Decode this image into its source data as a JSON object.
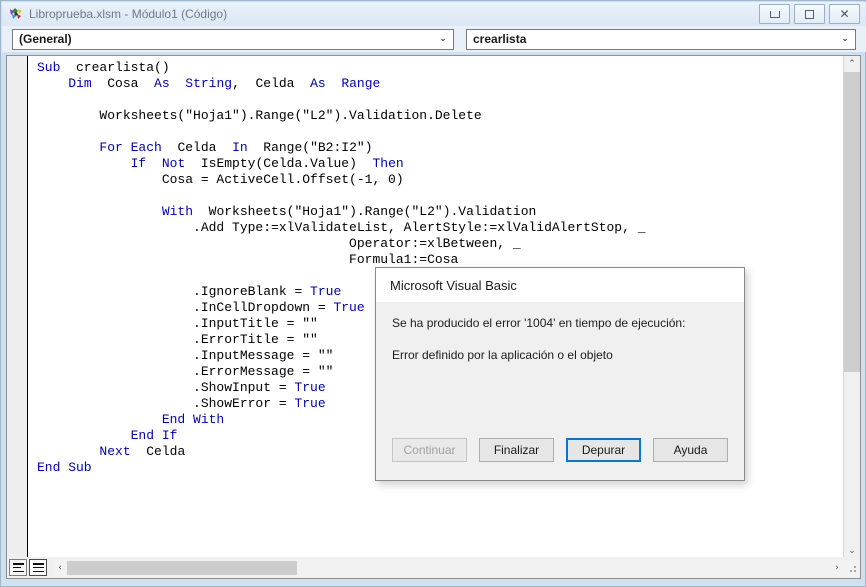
{
  "window": {
    "title": "Libroprueba.xlsm - Módulo1 (Código)",
    "icon": "vba-icon",
    "buttons": {
      "minimize": "minimize-button",
      "restore": "restore-button",
      "close": "close-button"
    }
  },
  "toolbar": {
    "object_combo": {
      "value": "(General)",
      "arrow": "⌄"
    },
    "procedure_combo": {
      "value": "crearlista",
      "arrow": "⌄"
    }
  },
  "code": {
    "lines": [
      [
        [
          "kw",
          "Sub"
        ],
        [
          "",
          "  crearlista()"
        ]
      ],
      [
        [
          "",
          "    "
        ],
        [
          "kw",
          "Dim"
        ],
        [
          "",
          "  Cosa  "
        ],
        [
          "kw",
          "As"
        ],
        [
          "",
          "  "
        ],
        [
          "kw",
          "String"
        ],
        [
          "",
          ",  Celda  "
        ],
        [
          "kw",
          "As"
        ],
        [
          "",
          "  "
        ],
        [
          "kw",
          "Range"
        ]
      ],
      [
        [
          "",
          ""
        ]
      ],
      [
        [
          "",
          "        Worksheets(\"Hoja1\").Range(\"L2\").Validation.Delete"
        ]
      ],
      [
        [
          "",
          ""
        ]
      ],
      [
        [
          "",
          "        "
        ],
        [
          "kw",
          "For Each"
        ],
        [
          "",
          "  Celda  "
        ],
        [
          "kw",
          "In"
        ],
        [
          "",
          "  Range(\"B2:I2\")"
        ]
      ],
      [
        [
          "",
          "            "
        ],
        [
          "kw",
          "If"
        ],
        [
          "",
          "  "
        ],
        [
          "kw",
          "Not"
        ],
        [
          "",
          "  IsEmpty(Celda.Value)  "
        ],
        [
          "kw",
          "Then"
        ]
      ],
      [
        [
          "",
          "                Cosa = ActiveCell.Offset(-1, 0)"
        ]
      ],
      [
        [
          "",
          ""
        ]
      ],
      [
        [
          "",
          "                "
        ],
        [
          "kw",
          "With"
        ],
        [
          "",
          "  Worksheets(\"Hoja1\").Range(\"L2\").Validation"
        ]
      ],
      [
        [
          "",
          "                    .Add Type:=xlValidateList, AlertStyle:=xlValidAlertStop, _"
        ]
      ],
      [
        [
          "",
          "                                        Operator:=xlBetween, _"
        ]
      ],
      [
        [
          "",
          "                                        Formula1:=Cosa"
        ]
      ],
      [
        [
          "",
          ""
        ]
      ],
      [
        [
          "",
          "                    .IgnoreBlank = "
        ],
        [
          "kw",
          "True"
        ]
      ],
      [
        [
          "",
          "                    .InCellDropdown = "
        ],
        [
          "kw",
          "True"
        ]
      ],
      [
        [
          "",
          "                    .InputTitle = \"\""
        ]
      ],
      [
        [
          "",
          "                    .ErrorTitle = \"\""
        ]
      ],
      [
        [
          "",
          "                    .InputMessage = \"\""
        ]
      ],
      [
        [
          "",
          "                    .ErrorMessage = \"\""
        ]
      ],
      [
        [
          "",
          "                    .ShowInput = "
        ],
        [
          "kw",
          "True"
        ]
      ],
      [
        [
          "",
          "                    .ShowError = "
        ],
        [
          "kw",
          "True"
        ]
      ],
      [
        [
          "",
          "                "
        ],
        [
          "kw",
          "End With"
        ]
      ],
      [
        [
          "",
          "            "
        ],
        [
          "kw",
          "End If"
        ]
      ],
      [
        [
          "",
          "        "
        ],
        [
          "kw",
          "Next"
        ],
        [
          "",
          "  Celda"
        ]
      ],
      [
        [
          "kw",
          "End Sub"
        ]
      ]
    ],
    "keyword_color": "#0000BF",
    "text_color": "#000000"
  },
  "scrollbars": {
    "vertical": {
      "up_arrow": "⌃",
      "down_arrow": "⌄"
    },
    "horizontal": {
      "left_arrow": "‹",
      "right_arrow": "›"
    }
  },
  "bottom_bar": {
    "procedure_view": "procedure-view-button",
    "full_module_view": "full-module-view-button"
  },
  "dialog": {
    "title": "Microsoft Visual Basic",
    "message_line1": "Se ha producido el error '1004' en tiempo de ejecución:",
    "message_line2": "Error definido por la aplicación o el objeto",
    "buttons": [
      {
        "label": "Continuar",
        "state": "disabled"
      },
      {
        "label": "Finalizar",
        "state": "normal"
      },
      {
        "label": "Depurar",
        "state": "focused"
      },
      {
        "label": "Ayuda",
        "state": "normal"
      }
    ],
    "focus_color": "#0078d7"
  }
}
